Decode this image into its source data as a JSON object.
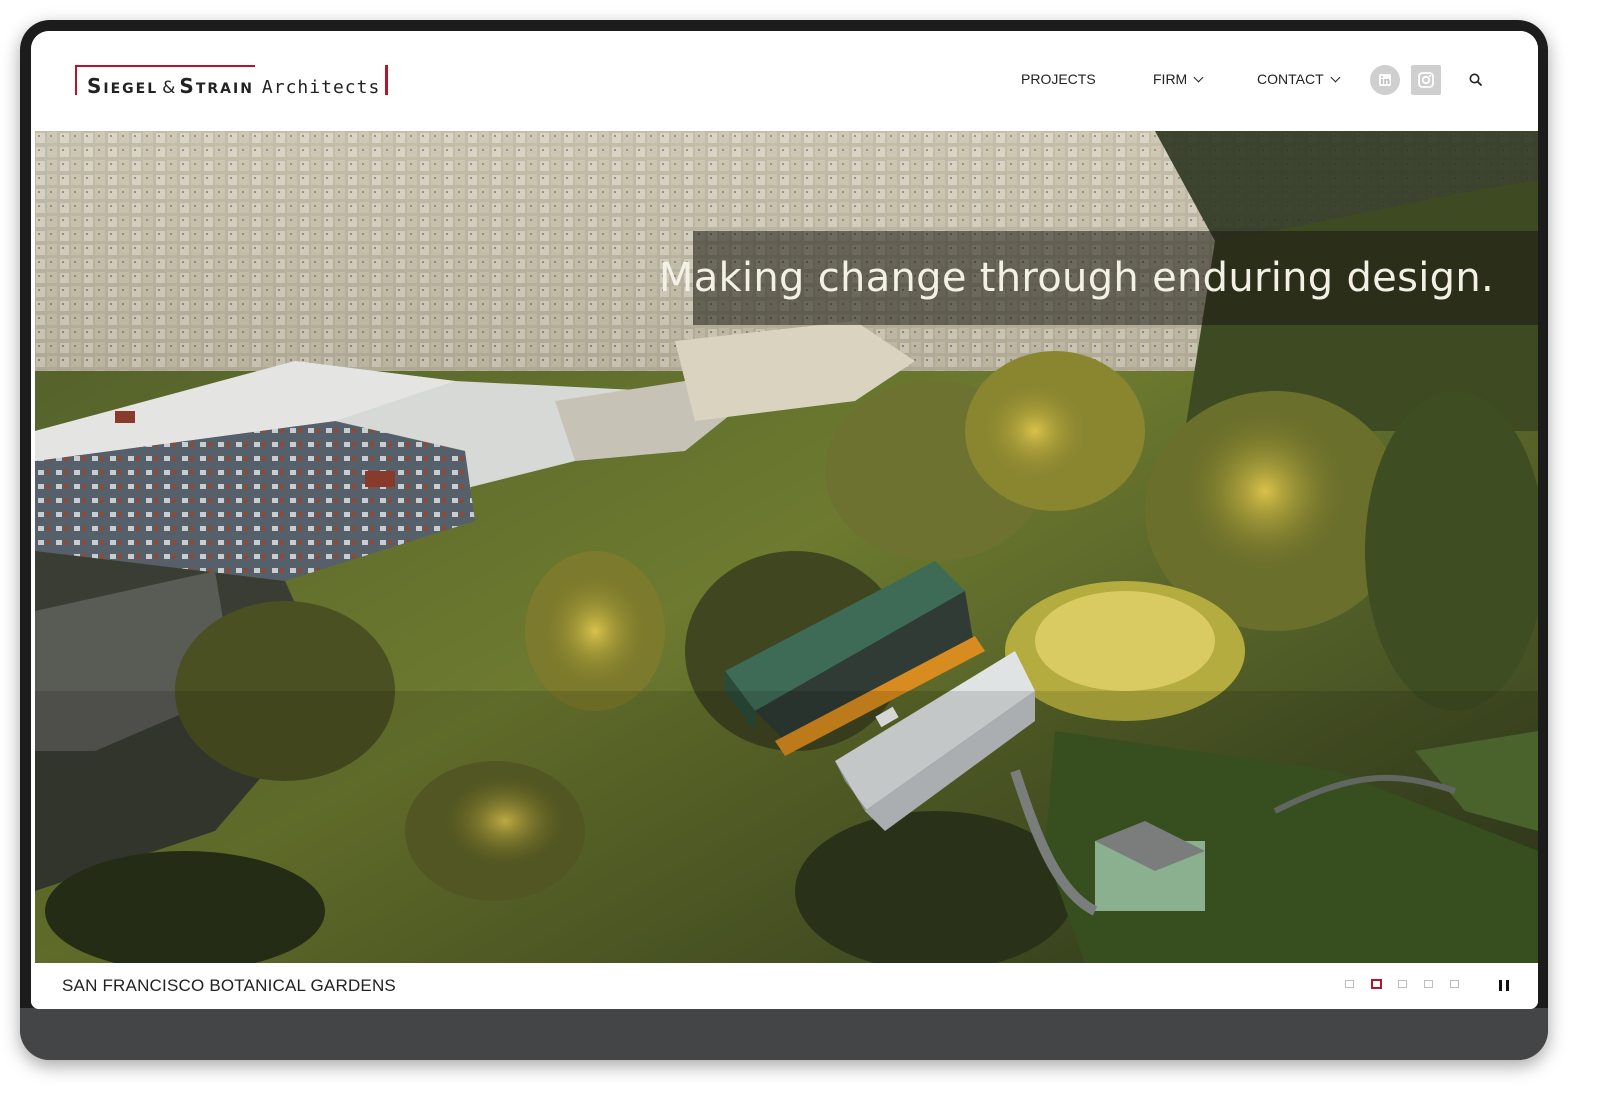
{
  "brand": {
    "name_part1": "Siegel",
    "ampersand": "&",
    "name_part2": "Strain",
    "suffix": "Architects",
    "accent_color": "#b0172a"
  },
  "nav": {
    "items": [
      {
        "label": "PROJECTS",
        "has_dropdown": false
      },
      {
        "label": "FIRM",
        "has_dropdown": true
      },
      {
        "label": "CONTACT",
        "has_dropdown": true
      }
    ],
    "social": [
      {
        "icon": "linkedin-icon"
      },
      {
        "icon": "instagram-icon"
      }
    ],
    "search_icon": "search-icon"
  },
  "hero": {
    "tagline": "Making change through enduring design.",
    "image_subject": "aerial-view-city-and-forest"
  },
  "slideshow": {
    "caption": "SAN FRANCISCO BOTANICAL GARDENS",
    "total_slides": 5,
    "active_slide": 2,
    "pause_icon": "pause-icon"
  }
}
